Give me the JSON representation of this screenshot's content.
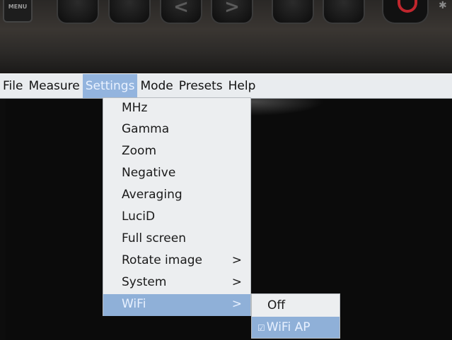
{
  "hardware": {
    "menu_label": "MENU",
    "buttons": [
      "",
      "",
      "<",
      ">",
      "",
      "",
      ""
    ],
    "power_color": "#c0262d"
  },
  "menubar": {
    "items": [
      {
        "label": "File"
      },
      {
        "label": "Measure"
      },
      {
        "label": "Settings",
        "active": true
      },
      {
        "label": "Mode"
      },
      {
        "label": "Presets"
      },
      {
        "label": "Help"
      }
    ]
  },
  "settings_menu": {
    "items": [
      {
        "label": "MHz"
      },
      {
        "label": "Gamma"
      },
      {
        "label": "Zoom"
      },
      {
        "label": "Negative"
      },
      {
        "label": "Averaging"
      },
      {
        "label": "LuciD"
      },
      {
        "label": "Full screen"
      },
      {
        "label": "Rotate image",
        "submenu_arrow": ">"
      },
      {
        "label": "System",
        "submenu_arrow": ">"
      },
      {
        "label": "WiFi",
        "submenu_arrow": ">",
        "active": true
      }
    ]
  },
  "wifi_submenu": {
    "items": [
      {
        "label": "Off"
      },
      {
        "label": "WiFi AP",
        "checked": true,
        "check_mark": "☑",
        "active": true
      }
    ]
  },
  "colors": {
    "highlight": "#8fb0d8",
    "menu_bg": "#eceef0"
  }
}
